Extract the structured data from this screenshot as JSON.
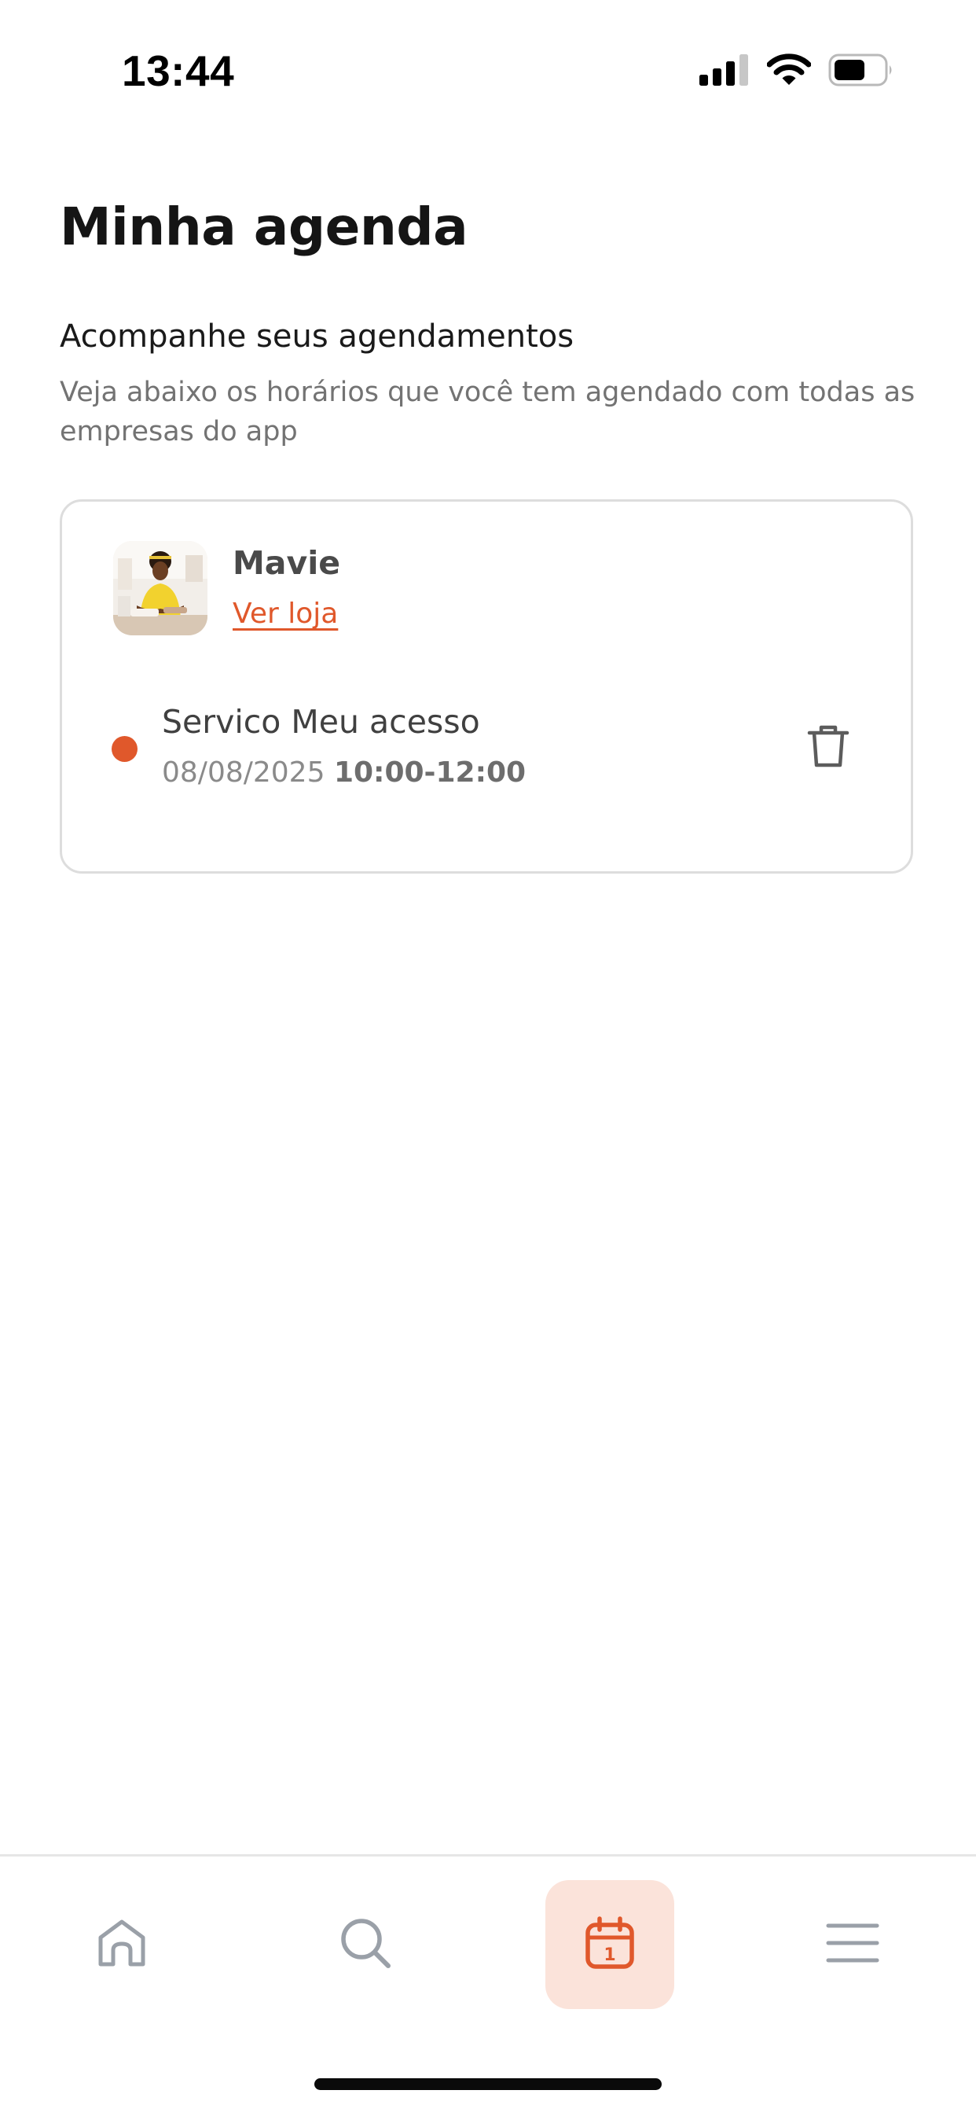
{
  "status_bar": {
    "time": "13:44",
    "icons": [
      "cellular-signal-icon",
      "wifi-icon",
      "battery-icon"
    ]
  },
  "page": {
    "title": "Minha agenda",
    "section_heading": "Acompanhe seus agendamentos",
    "section_description": "Veja abaixo os horários que você tem agendado com todas as empresas do app"
  },
  "appointments": [
    {
      "store_name": "Mavie",
      "store_link_label": "Ver loja",
      "service_name": "Servico Meu acesso",
      "date": "08/08/2025",
      "time_range": "10:00-12:00",
      "status_color": "#e0582b",
      "delete_icon": "trash-icon"
    }
  ],
  "tab_bar": {
    "items": [
      {
        "icon": "home-icon",
        "active": false
      },
      {
        "icon": "search-icon",
        "active": false
      },
      {
        "icon": "calendar-icon",
        "active": true,
        "badge_day": "1"
      },
      {
        "icon": "menu-icon",
        "active": false
      }
    ]
  },
  "colors": {
    "accent": "#e0582b",
    "active_tab_background": "#fbe3da",
    "inactive_icon": "#9aa0a8"
  }
}
